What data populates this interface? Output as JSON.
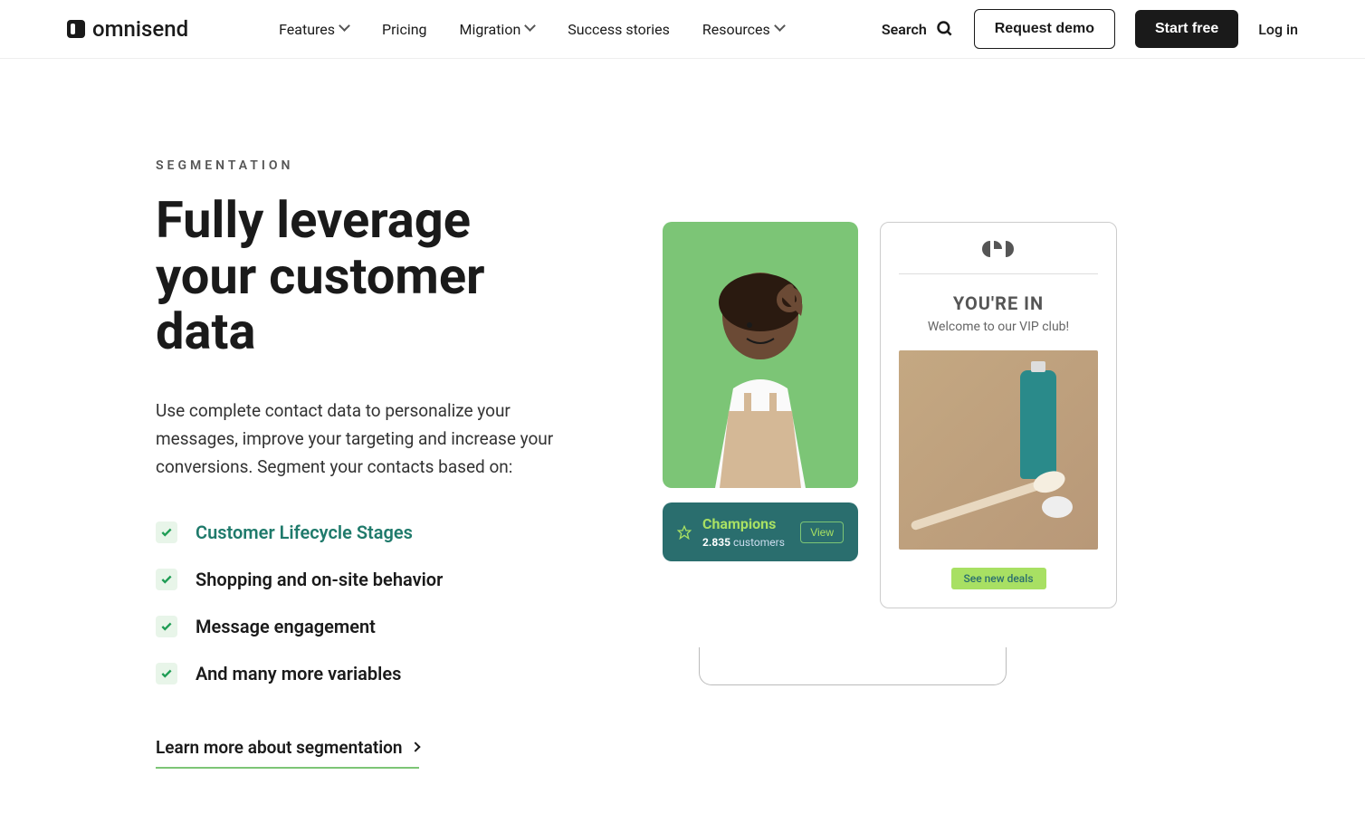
{
  "brand": "omnisend",
  "nav": {
    "features": "Features",
    "pricing": "Pricing",
    "migration": "Migration",
    "stories": "Success stories",
    "resources": "Resources"
  },
  "header": {
    "search": "Search",
    "demo": "Request demo",
    "start": "Start free",
    "login": "Log in"
  },
  "hero": {
    "eyebrow": "SEGMENTATION",
    "title": "Fully leverage your customer data",
    "desc": "Use complete contact data to personalize your messages, improve your targeting and increase your conversions. Segment your contacts based on:",
    "bullets": [
      "Customer Lifecycle Stages",
      "Shopping and on-site behavior",
      "Message engagement",
      "And many more variables"
    ],
    "learn": "Learn more about segmentation"
  },
  "segment": {
    "title": "Champions",
    "count": "2.835",
    "label": "customers",
    "view": "View"
  },
  "email": {
    "title": "YOU'RE IN",
    "sub": "Welcome to our VIP club!",
    "cta": "See new deals"
  }
}
